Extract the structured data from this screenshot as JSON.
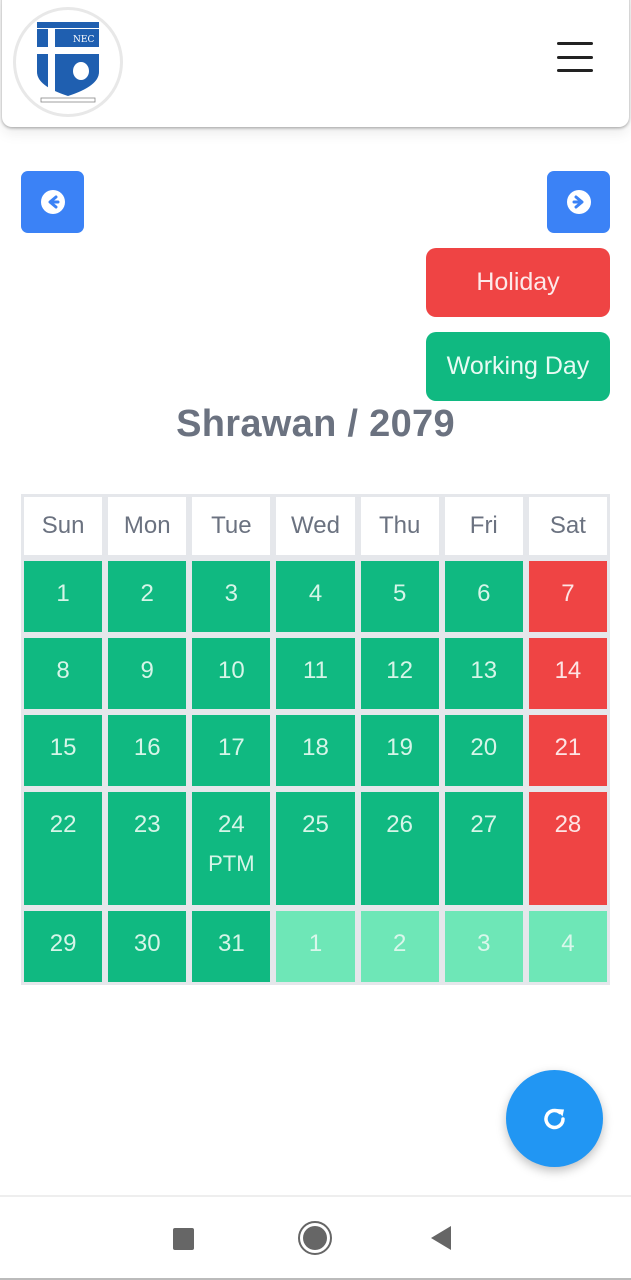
{
  "header": {
    "logo": {
      "alt": "school-crest",
      "crest_text": "NEC",
      "colors": {
        "shield": "#1f5fb0",
        "cross": "#ffffff"
      }
    },
    "menu_icon": "hamburger-icon"
  },
  "navigation": {
    "prev_icon": "arrow-left-circle-icon",
    "next_icon": "arrow-right-circle-icon"
  },
  "legend": {
    "holiday_label": "Holiday",
    "working_label": "Working Day",
    "colors": {
      "holiday": "#ef4444",
      "working": "#10b981",
      "other_month": "#6ee7b7"
    }
  },
  "calendar": {
    "month": "Shrawan",
    "year": "2079",
    "title": "Shrawan / 2079",
    "weekdays": [
      "Sun",
      "Mon",
      "Tue",
      "Wed",
      "Thu",
      "Fri",
      "Sat"
    ],
    "weeks": [
      [
        {
          "day": "1",
          "type": "working"
        },
        {
          "day": "2",
          "type": "working"
        },
        {
          "day": "3",
          "type": "working"
        },
        {
          "day": "4",
          "type": "working"
        },
        {
          "day": "5",
          "type": "working"
        },
        {
          "day": "6",
          "type": "working"
        },
        {
          "day": "7",
          "type": "holiday"
        }
      ],
      [
        {
          "day": "8",
          "type": "working"
        },
        {
          "day": "9",
          "type": "working"
        },
        {
          "day": "10",
          "type": "working"
        },
        {
          "day": "11",
          "type": "working"
        },
        {
          "day": "12",
          "type": "working"
        },
        {
          "day": "13",
          "type": "working"
        },
        {
          "day": "14",
          "type": "holiday"
        }
      ],
      [
        {
          "day": "15",
          "type": "working"
        },
        {
          "day": "16",
          "type": "working"
        },
        {
          "day": "17",
          "type": "working"
        },
        {
          "day": "18",
          "type": "working"
        },
        {
          "day": "19",
          "type": "working"
        },
        {
          "day": "20",
          "type": "working"
        },
        {
          "day": "21",
          "type": "holiday"
        }
      ],
      [
        {
          "day": "22",
          "type": "working"
        },
        {
          "day": "23",
          "type": "working"
        },
        {
          "day": "24",
          "type": "working",
          "note": "PTM"
        },
        {
          "day": "25",
          "type": "working"
        },
        {
          "day": "26",
          "type": "working"
        },
        {
          "day": "27",
          "type": "working"
        },
        {
          "day": "28",
          "type": "holiday"
        }
      ],
      [
        {
          "day": "29",
          "type": "working"
        },
        {
          "day": "30",
          "type": "working"
        },
        {
          "day": "31",
          "type": "working"
        },
        {
          "day": "1",
          "type": "other"
        },
        {
          "day": "2",
          "type": "other"
        },
        {
          "day": "3",
          "type": "other"
        },
        {
          "day": "4",
          "type": "other"
        }
      ]
    ]
  },
  "fab": {
    "icon": "refresh-icon"
  },
  "system_nav": {
    "recents_icon": "square-recents-icon",
    "home_icon": "circle-home-icon",
    "back_icon": "triangle-back-icon"
  }
}
